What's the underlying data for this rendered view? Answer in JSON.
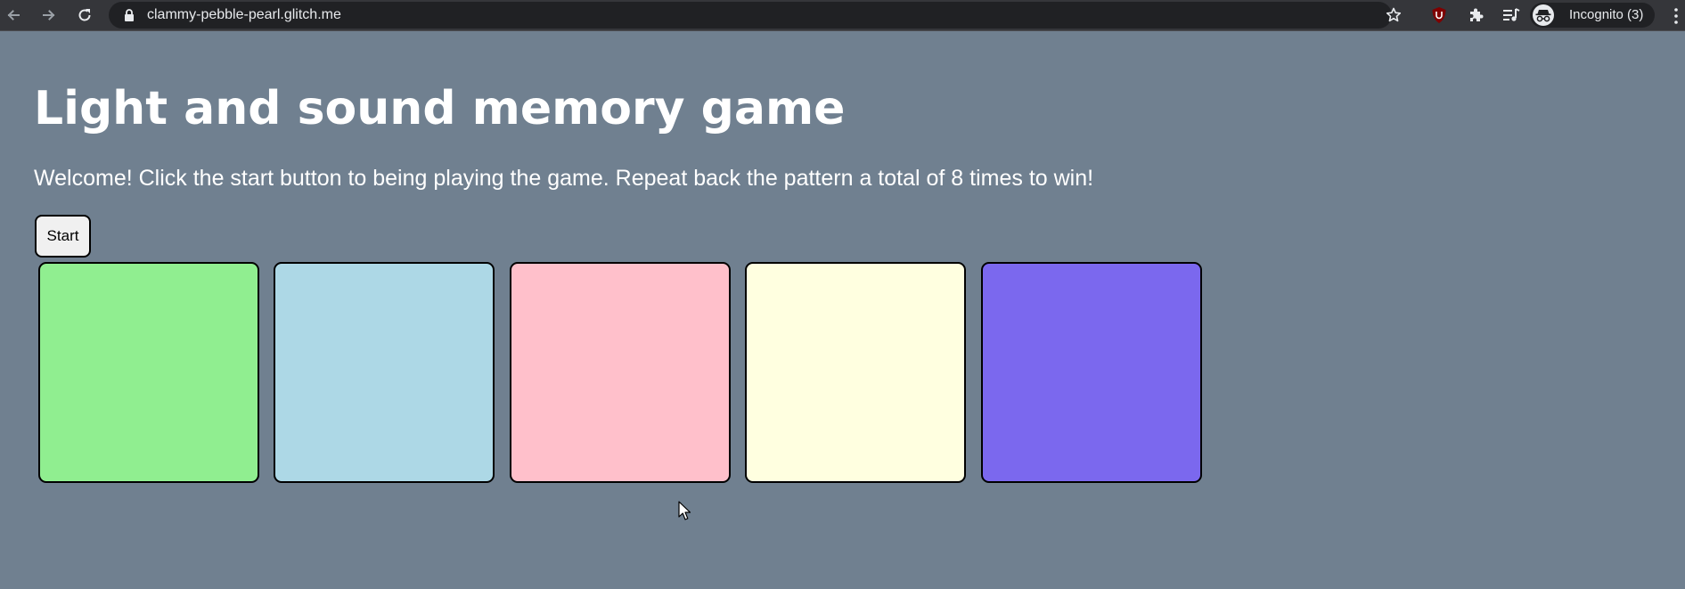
{
  "browser": {
    "url": "clammy-pebble-pearl.glitch.me",
    "profile_label": "Incognito (3)",
    "colors": {
      "toolbar": "#35363a",
      "omnibox": "#202124",
      "text": "#e8eaed"
    }
  },
  "page": {
    "title": "Light and sound memory game",
    "welcome": "Welcome! Click the start button to being playing the game. Repeat back the pattern a total of 8 times to win!",
    "start_label": "Start",
    "background_color": "#708090",
    "game_buttons": [
      {
        "color": "#90ee90"
      },
      {
        "color": "#add8e6"
      },
      {
        "color": "#ffc0cb"
      },
      {
        "color": "#ffffe0"
      },
      {
        "color": "#7b68ee"
      }
    ]
  },
  "icons": {
    "back": "arrow-left",
    "forward": "arrow-right",
    "reload": "reload",
    "lock": "lock",
    "bookmark": "star-outline",
    "ublock": "ublock-origin-shield",
    "extensions": "puzzle-piece",
    "media": "media-queue",
    "profile": "incognito",
    "menu": "kebab-menu"
  }
}
